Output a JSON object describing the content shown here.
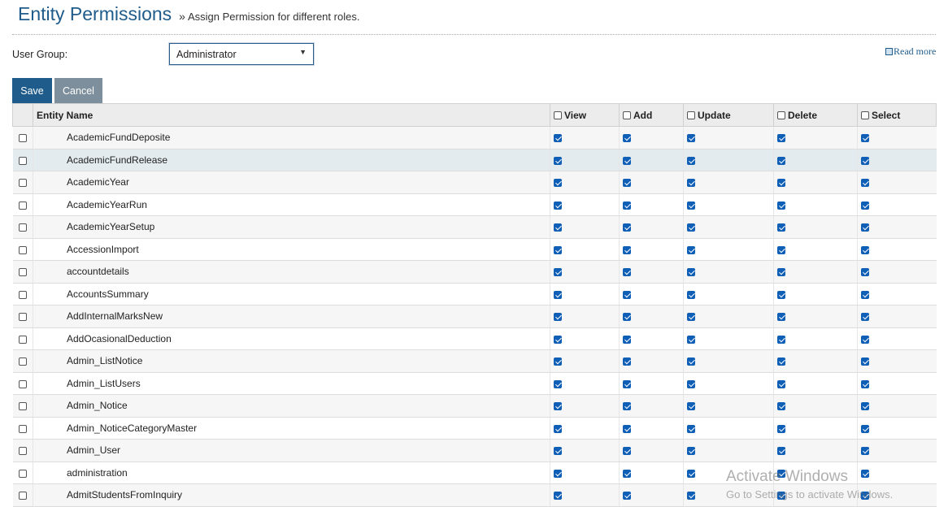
{
  "header": {
    "title": "Entity Permissions",
    "subtitle_prefix": "»",
    "subtitle": "Assign Permission for different roles."
  },
  "user_group": {
    "label": "User Group:",
    "selected": "Administrator"
  },
  "read_more": "Read more",
  "buttons": {
    "save": "Save",
    "cancel": "Cancel"
  },
  "table": {
    "columns": [
      "Entity Name",
      "View",
      "Add",
      "Update",
      "Delete",
      "Select"
    ],
    "rows": [
      "AcademicFundDeposite",
      "AcademicFundRelease",
      "AcademicYear",
      "AcademicYearRun",
      "AcademicYearSetup",
      "AccessionImport",
      "accountdetails",
      "AccountsSummary",
      "AddInternalMarksNew",
      "AddOcasionalDeduction",
      "Admin_ListNotice",
      "Admin_ListUsers",
      "Admin_Notice",
      "Admin_NoticeCategoryMaster",
      "Admin_User",
      "administration",
      "AdmitStudentsFromInquiry"
    ],
    "row_checked": false,
    "permissions_checked": true,
    "header_checkboxes_checked": false,
    "highlighted_row_index": 1
  },
  "watermark": {
    "line1": "Activate Windows",
    "line2": "Go to Settings to activate Windows."
  },
  "colors": {
    "accent": "#1f5c8b",
    "checkbox": "#0f5fb7",
    "cancel": "#7d8f9c"
  },
  "icons": {
    "read_more": "book-icon",
    "dropdown": "caret-down-icon"
  }
}
